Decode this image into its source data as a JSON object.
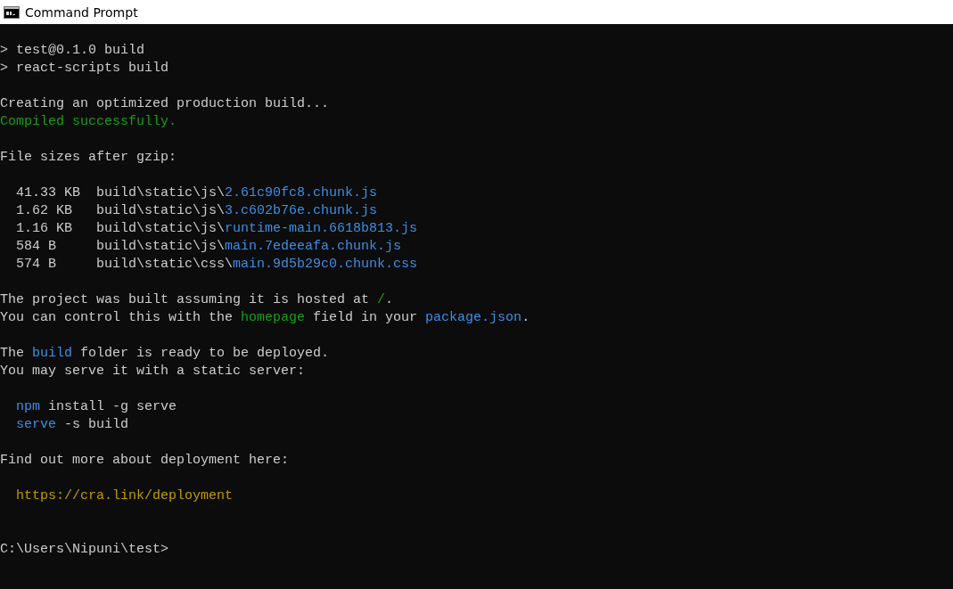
{
  "window": {
    "title": "Command Prompt"
  },
  "console": {
    "blocks": [
      [
        {
          "indented": false,
          "segments": [
            {
              "text": "> test@0.1.0 build",
              "kind": "plain"
            }
          ]
        },
        {
          "indented": false,
          "segments": [
            {
              "text": "> react-scripts build",
              "kind": "plain"
            }
          ]
        }
      ],
      [
        {
          "indented": false,
          "segments": [
            {
              "text": "Creating an optimized production build...",
              "kind": "plain"
            }
          ]
        },
        {
          "indented": false,
          "segments": [
            {
              "text": "Compiled successfully.",
              "kind": "success"
            }
          ]
        }
      ],
      [
        {
          "indented": false,
          "segments": [
            {
              "text": "File sizes after gzip:",
              "kind": "plain"
            }
          ]
        }
      ],
      [
        {
          "indented": true,
          "segments": [
            {
              "text": "41.33 KB  build\\static\\js\\",
              "kind": "plain"
            },
            {
              "text": "2.61c90fc8.chunk.js",
              "kind": "accent"
            }
          ]
        },
        {
          "indented": true,
          "segments": [
            {
              "text": "1.62 KB   build\\static\\js\\",
              "kind": "plain"
            },
            {
              "text": "3.c602b76e.chunk.js",
              "kind": "accent"
            }
          ]
        },
        {
          "indented": true,
          "segments": [
            {
              "text": "1.16 KB   build\\static\\js\\",
              "kind": "plain"
            },
            {
              "text": "runtime-main.6618b813.js",
              "kind": "accent"
            }
          ]
        },
        {
          "indented": true,
          "segments": [
            {
              "text": "584 B     build\\static\\js\\",
              "kind": "plain"
            },
            {
              "text": "main.7edeeafa.chunk.js",
              "kind": "accent"
            }
          ]
        },
        {
          "indented": true,
          "segments": [
            {
              "text": "574 B     build\\static\\css\\",
              "kind": "plain"
            },
            {
              "text": "main.9d5b29c0.chunk.css",
              "kind": "accent"
            }
          ]
        }
      ],
      [
        {
          "indented": false,
          "segments": [
            {
              "text": "The project was built assuming it is hosted at ",
              "kind": "plain"
            },
            {
              "text": "/",
              "kind": "success"
            },
            {
              "text": ".",
              "kind": "plain"
            }
          ]
        },
        {
          "indented": false,
          "segments": [
            {
              "text": "You can control this with the ",
              "kind": "plain"
            },
            {
              "text": "homepage",
              "kind": "success"
            },
            {
              "text": " field in your ",
              "kind": "plain"
            },
            {
              "text": "package.json",
              "kind": "accent"
            },
            {
              "text": ".",
              "kind": "plain"
            }
          ]
        }
      ],
      [
        {
          "indented": false,
          "segments": [
            {
              "text": "The ",
              "kind": "plain"
            },
            {
              "text": "build",
              "kind": "accent"
            },
            {
              "text": " folder is ready to be deployed.",
              "kind": "plain"
            }
          ]
        },
        {
          "indented": false,
          "segments": [
            {
              "text": "You may serve it with a static server:",
              "kind": "plain"
            }
          ]
        }
      ],
      [
        {
          "indented": true,
          "segments": [
            {
              "text": "npm",
              "kind": "accent"
            },
            {
              "text": " install -g serve",
              "kind": "plain"
            }
          ]
        },
        {
          "indented": true,
          "segments": [
            {
              "text": "serve",
              "kind": "accent"
            },
            {
              "text": " -s build",
              "kind": "plain"
            }
          ]
        }
      ],
      [
        {
          "indented": false,
          "segments": [
            {
              "text": "Find out more about deployment here:",
              "kind": "plain"
            }
          ]
        }
      ],
      [
        {
          "indented": true,
          "segments": [
            {
              "text": "https://cra.link/deployment",
              "kind": "link"
            }
          ]
        }
      ]
    ],
    "prompt": "C:\\Users\\Nipuni\\test>"
  }
}
